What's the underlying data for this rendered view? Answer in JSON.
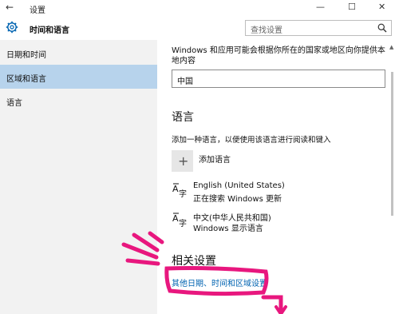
{
  "window": {
    "title": "设置",
    "back_glyph": "←",
    "minimize": "—",
    "maximize": "☐",
    "close": "✕"
  },
  "header": {
    "section_title": "时间和语言",
    "search_placeholder": "查找设置"
  },
  "sidebar": {
    "items": [
      {
        "label": "日期和时间"
      },
      {
        "label": "区域和语言"
      },
      {
        "label": "语言"
      }
    ],
    "active_index": 1
  },
  "content": {
    "region_desc": "Windows 和应用可能会根据你所在的国家或地区向你提供本地内容",
    "region_value": "中国",
    "languages_heading": "语言",
    "languages_hint": "添加一种语言，以便使用该语言进行阅读和键入",
    "add_language_glyph": "+",
    "add_language_label": "添加语言",
    "languages": [
      {
        "name": "English (United States)",
        "status": "正在搜索 Windows 更新"
      },
      {
        "name": "中文(中华人民共和国)",
        "status": "Windows 显示语言"
      }
    ],
    "related_heading": "相关设置",
    "related_link": "其他日期、时间和区域设置"
  },
  "colors": {
    "accent": "#0063b1",
    "highlight": "#b7d3ec",
    "annotation": "#e8177e"
  }
}
